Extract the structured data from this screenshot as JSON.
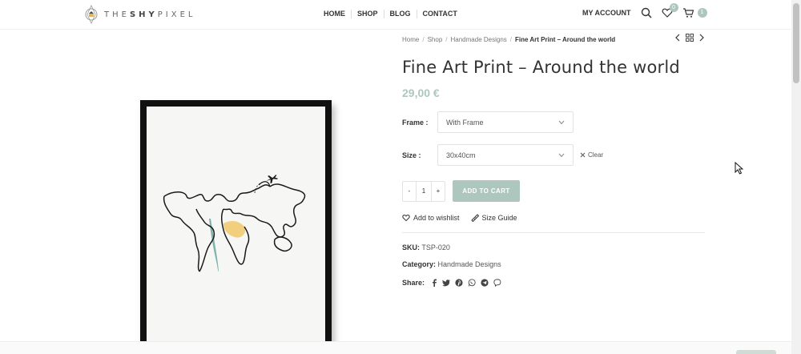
{
  "brand": {
    "logo_text_light": "THE",
    "logo_text_bold": "SHY",
    "logo_text_rest": "PIXEL"
  },
  "nav": {
    "items": [
      "HOME",
      "SHOP",
      "BLOG",
      "CONTACT"
    ]
  },
  "header": {
    "account_label": "MY ACCOUNT",
    "wishlist_count": "0",
    "cart_count": "1"
  },
  "breadcrumb": {
    "items": [
      "Home",
      "Shop",
      "Handmade Designs"
    ],
    "current": "Fine Art Print – Around the world"
  },
  "product": {
    "title": "Fine Art Print – Around the world",
    "price": "29,00 €",
    "frame_label": "Frame :",
    "frame_value": "With Frame",
    "size_label": "Size :",
    "size_value": "30x40cm",
    "clear_label": "Clear",
    "qty_minus": "-",
    "qty_value": "1",
    "qty_plus": "+",
    "add_to_cart": "ADD TO CART",
    "wishlist_label": "Add to wishlist",
    "size_guide_label": "Size Guide",
    "sku_label": "SKU:",
    "sku_value": "TSP-020",
    "category_label": "Category:",
    "category_value": "Handmade Designs",
    "share_label": "Share:"
  },
  "colors": {
    "accent": "#aec7be",
    "text": "#333333",
    "map_yellow": "#f2cf7e",
    "map_teal": "#7fb3ae"
  },
  "icons": {
    "share": [
      "facebook-icon",
      "twitter-icon",
      "pinterest-icon",
      "whatsapp-icon",
      "telegram-icon",
      "viber-icon"
    ]
  }
}
